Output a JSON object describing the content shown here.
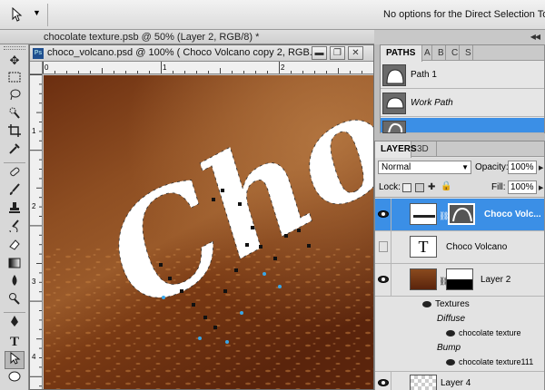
{
  "options_bar": {
    "tool_icon": "direct-selection-arrow-icon",
    "message": "No options for the Direct Selection Tool."
  },
  "background_doc": {
    "title": "chocolate texture.psb @ 50% (Layer 2, RGB/8) *"
  },
  "document": {
    "app_badge": "Ps",
    "title": "choco_volcano.psd @ 100% ( Choco Volcano copy 2, RGB...",
    "canvas_text": "Choc",
    "ruler_top_labels": [
      "0",
      "1",
      "2"
    ],
    "ruler_left_labels": [
      "1",
      "2",
      "3",
      "4"
    ]
  },
  "paths_panel": {
    "tabs": [
      "PATHS",
      "A",
      "B",
      "C",
      "S"
    ],
    "rows": [
      {
        "name": "Path 1",
        "style": "normal",
        "selected": false
      },
      {
        "name": "Work Path",
        "style": "italic",
        "selected": false
      },
      {
        "name": "",
        "style": "normal",
        "selected": true
      }
    ]
  },
  "layers_panel": {
    "tabs": [
      "LAYERS",
      "3D"
    ],
    "blend_mode": "Normal",
    "opacity_label": "Opacity:",
    "opacity_value": "100%",
    "lock_label": "Lock:",
    "fill_label": "Fill:",
    "fill_value": "100%",
    "layers": [
      {
        "name": "Choco Volc...",
        "selected": true
      },
      {
        "name": "Choco Volcano",
        "selected": false
      },
      {
        "name": "Layer 2",
        "selected": false
      },
      {
        "name": "Layer 4",
        "selected": false
      }
    ],
    "effects": {
      "textures_label": "Textures",
      "diffuse_label": "Diffuse",
      "diffuse_item": "chocolate texture",
      "bump_label": "Bump",
      "bump_item": "chocolate texture111"
    }
  },
  "colors": {
    "selection": "#3b8fe6",
    "chocolate": "#8a4a1e"
  }
}
